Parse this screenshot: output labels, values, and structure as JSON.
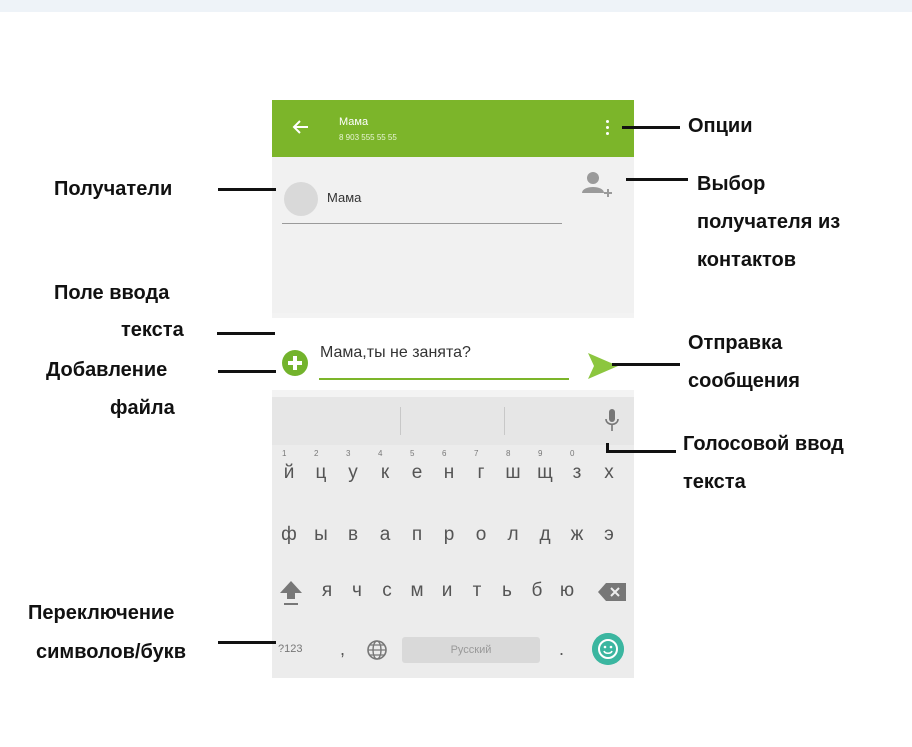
{
  "appbar": {
    "contact_name": "Мама",
    "contact_phone": "8 903 555 55 55"
  },
  "recipients": {
    "chip_label": "Мама"
  },
  "compose": {
    "message_text": "Мама,ты не занята?"
  },
  "keyboard": {
    "row1": [
      {
        "hint": "1",
        "key": "й"
      },
      {
        "hint": "2",
        "key": "ц"
      },
      {
        "hint": "3",
        "key": "у"
      },
      {
        "hint": "4",
        "key": "к"
      },
      {
        "hint": "5",
        "key": "е"
      },
      {
        "hint": "6",
        "key": "н"
      },
      {
        "hint": "7",
        "key": "г"
      },
      {
        "hint": "8",
        "key": "ш"
      },
      {
        "hint": "9",
        "key": "щ"
      },
      {
        "hint": "0",
        "key": "з"
      },
      {
        "hint": "",
        "key": "х"
      }
    ],
    "row2": [
      "ф",
      "ы",
      "в",
      "а",
      "п",
      "р",
      "о",
      "л",
      "д",
      "ж",
      "э"
    ],
    "row3": [
      "я",
      "ч",
      "с",
      "м",
      "и",
      "т",
      "ь",
      "б",
      "ю"
    ],
    "symbols_key": "?123",
    "comma_key": ",",
    "space_label": "Русский",
    "period_key": "."
  },
  "annotations": {
    "options": "Опции",
    "recipients": "Получатели",
    "pick_recipient_line1": "Выбор",
    "pick_recipient_line2": "получателя из",
    "pick_recipient_line3": "контактов",
    "input_field_line1": "Поле ввода",
    "input_field_line2": "текста",
    "add_file_line1": "Добавление",
    "add_file_line2": "файла",
    "send_line1": "Отправка",
    "send_line2": "сообщения",
    "voice_line1": "Голосовой ввод",
    "voice_line2": "текста",
    "switch_line1": "Переключение",
    "switch_line2": "символов/букв"
  },
  "colors": {
    "accent": "#7cb52a",
    "emoji_button": "#3bb6a0"
  },
  "icons": [
    "back-arrow-icon",
    "overflow-menu-icon",
    "add-contact-icon",
    "attach-plus-icon",
    "send-icon",
    "mic-icon",
    "shift-icon",
    "backspace-icon",
    "globe-icon",
    "emoji-icon"
  ]
}
